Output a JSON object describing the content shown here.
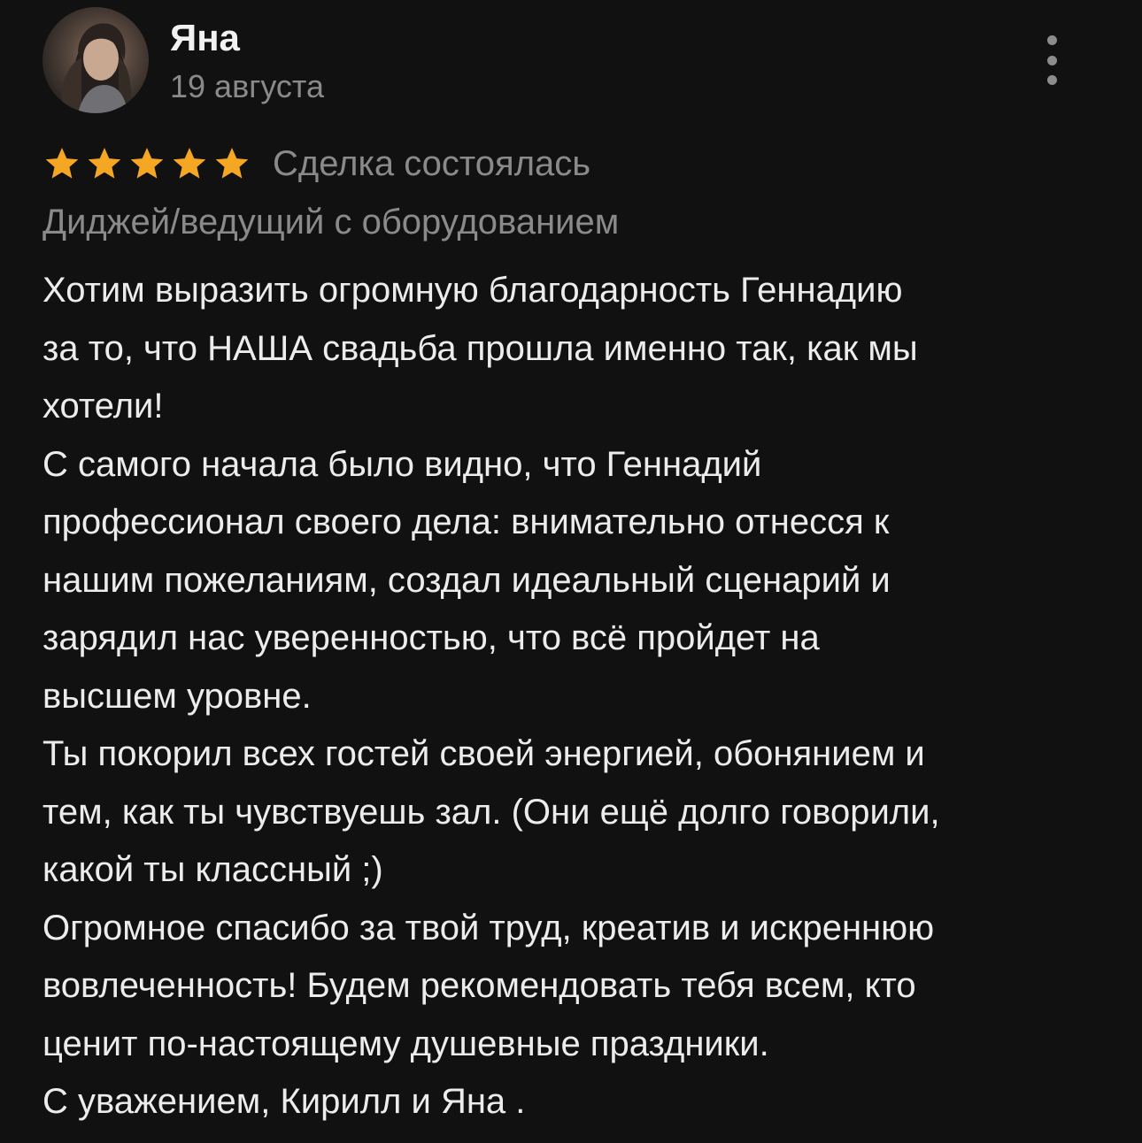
{
  "author": {
    "name": "Яна",
    "date": "19 августа"
  },
  "menu": {
    "icon": "more-vertical-icon"
  },
  "rating": {
    "stars": 5,
    "max_stars": 5,
    "star_color": "#f5a623",
    "status": "Сделка состоялась"
  },
  "service": "Диджей/ведущий с оборудованием",
  "review": {
    "lines": [
      "Хотим выразить огромную благодарность Геннадию",
      "за то, что НАША свадьба прошла именно так, как мы",
      "хотели!",
      "С самого начала было видно, что Геннадий",
      "профессионал своего дела: внимательно отнесся к",
      "нашим пожеланиям, создал  идеальный сценарий и",
      "зарядил нас уверенностью, что всё пройдет на",
      "высшем уровне.",
      "Ты покорил всех гостей своей энергией, обонянием и",
      "тем, как ты чувствуешь зал. (Они ещё долго говорили,",
      "какой ты классный ;)",
      "Огромное спасибо за твой труд, креатив и искреннюю",
      "вовлеченность! Будем рекомендовать тебя всем, кто",
      "ценит по-настоящему душевные праздники.",
      "С уважением, Кирилл и Яна ."
    ]
  },
  "colors": {
    "background": "#111111",
    "text_primary": "#ececec",
    "text_secondary": "#8a8a8a",
    "star": "#f5a623"
  }
}
